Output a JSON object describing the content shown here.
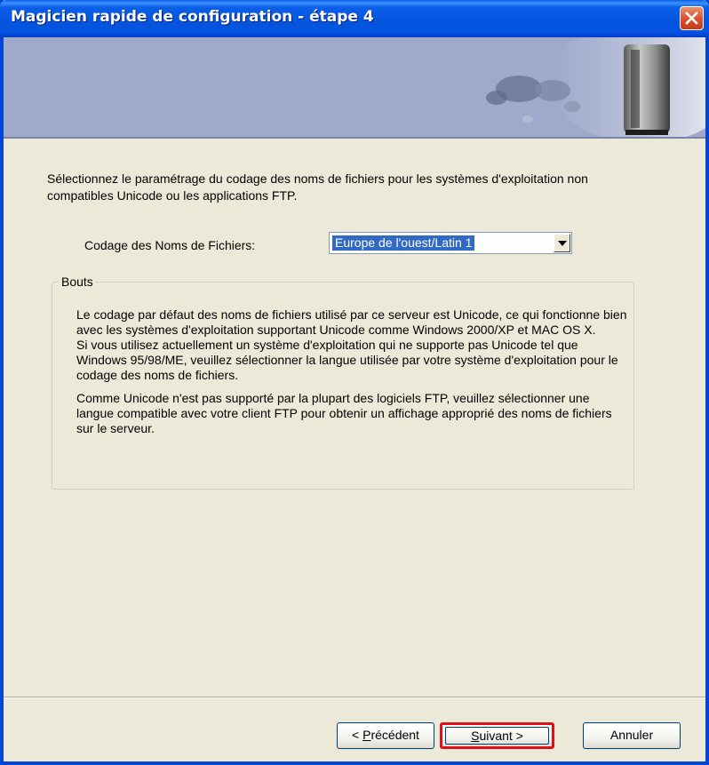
{
  "window": {
    "title": "Magicien rapide de configuration - étape 4"
  },
  "intro_text": "Sélectionnez le paramétrage du codage des noms de fichiers pour les systèmes d'exploitation non compatibles Unicode ou les applications FTP.",
  "encoding": {
    "label": "Codage des Noms de Fichiers:",
    "selected": "Europe de l'ouest/Latin 1"
  },
  "tips": {
    "legend": "Bouts",
    "paragraph1a": "Le codage par défaut des noms de fichiers utilisé par ce serveur est Unicode, ce qui fonctionne bien avec les systèmes d'exploitation supportant Unicode comme Windows 2000/XP et MAC OS X.",
    "paragraph1b": "Si vous utilisez actuellement un système d'exploitation qui ne supporte pas Unicode tel que Windows 95/98/ME, veuillez sélectionner la langue utilisée par votre système d'exploitation pour le codage des noms de fichiers.",
    "paragraph2": "Comme Unicode n'est pas supporté par la plupart des logiciels FTP, veuillez sélectionner une langue compatible avec votre client FTP pour obtenir un affichage approprié des noms de fichiers sur le serveur."
  },
  "buttons": {
    "prev_mnemonic": "P",
    "prev_rest": "récédent",
    "prev_prefix": "< ",
    "next_mnemonic": "S",
    "next_rest": "uivant >",
    "cancel": "Annuler"
  },
  "colors": {
    "titlebar": "#0455DD",
    "dialog_bg": "#ECE9D8",
    "banner_bg": "#9EA9CB",
    "selection": "#316AC5",
    "highlight_border": "#E0101B"
  }
}
